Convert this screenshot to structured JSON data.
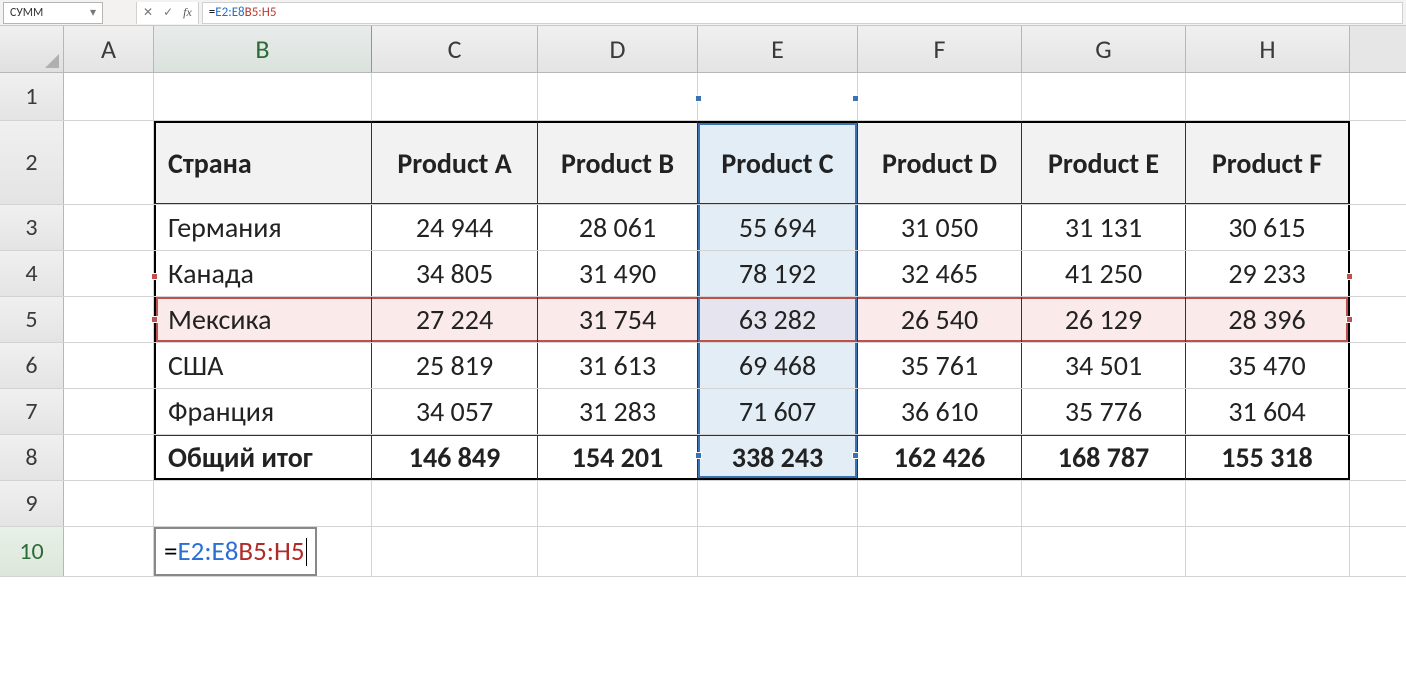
{
  "namebox": "СУММ",
  "formula_bar": {
    "prefix": "=",
    "ref1": "E2:E8",
    "sep": " ",
    "ref2": "B5:H5"
  },
  "columns": [
    "A",
    "B",
    "C",
    "D",
    "E",
    "F",
    "G",
    "H"
  ],
  "row_numbers": [
    "1",
    "2",
    "3",
    "4",
    "5",
    "6",
    "7",
    "8",
    "9",
    "10"
  ],
  "table": {
    "header_country": "Страна",
    "products": [
      "Product A",
      "Product B",
      "Product C",
      "Product D",
      "Product E",
      "Product F"
    ],
    "rows": [
      {
        "country": "Германия",
        "v": [
          "24 944",
          "28 061",
          "55 694",
          "31 050",
          "31 131",
          "30 615"
        ]
      },
      {
        "country": "Канада",
        "v": [
          "34 805",
          "31 490",
          "78 192",
          "32 465",
          "41 250",
          "29 233"
        ]
      },
      {
        "country": "Мексика",
        "v": [
          "27 224",
          "31 754",
          "63 282",
          "26 540",
          "26 129",
          "28 396"
        ]
      },
      {
        "country": "США",
        "v": [
          "25 819",
          "31 613",
          "69 468",
          "35 761",
          "34 501",
          "35 470"
        ]
      },
      {
        "country": "Франция",
        "v": [
          "34 057",
          "31 283",
          "71 607",
          "36 610",
          "35 776",
          "31 604"
        ]
      }
    ],
    "total_label": "Общий итог",
    "totals": [
      "146 849",
      "154 201",
      "338 243",
      "162 426",
      "168 787",
      "155 318"
    ]
  },
  "editing_cell": {
    "prefix": "=",
    "ref1": "E2:E8",
    "sep": " ",
    "ref2": "B5:H5"
  },
  "icons": {
    "cancel": "✕",
    "enter": "✓",
    "fx": "fx",
    "dropdown": "▾"
  }
}
